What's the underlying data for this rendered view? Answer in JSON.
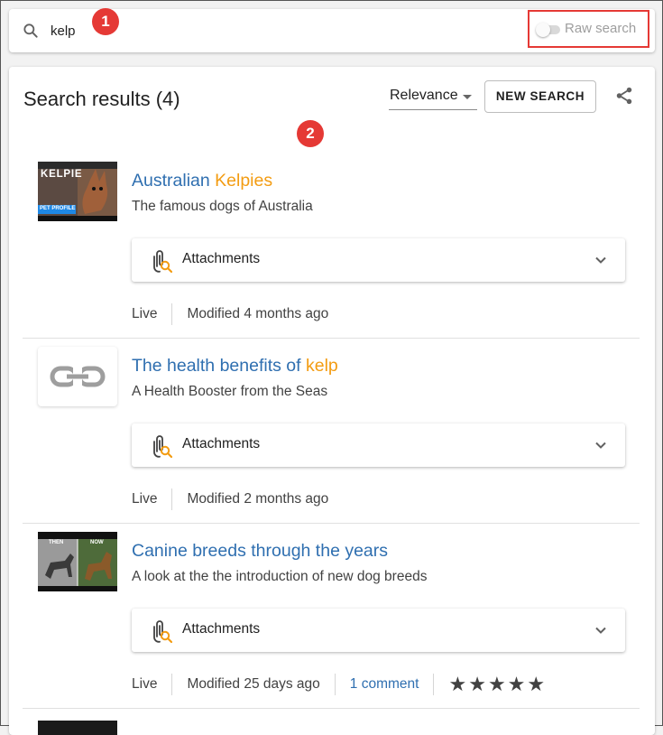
{
  "search": {
    "query": "kelp",
    "raw_search_label": "Raw search",
    "raw_search_on": false
  },
  "markers": [
    "1",
    "2"
  ],
  "results_header": {
    "title": "Search results (4)",
    "sort_value": "Relevance",
    "new_search_label": "NEW SEARCH"
  },
  "results": [
    {
      "title_prefix": "Australian ",
      "title_highlight": "Kelpies",
      "title_suffix": "",
      "subtitle": "The famous dogs of Australia",
      "thumb_text": "KELPIE",
      "thumb_tag": "PET PROFILE",
      "attachments_label": "Attachments",
      "status": "Live",
      "modified": "Modified 4 months ago"
    },
    {
      "title_prefix": "The health benefits of ",
      "title_highlight": "kelp",
      "title_suffix": "",
      "subtitle": "A Health Booster from the Seas",
      "attachments_label": "Attachments",
      "status": "Live",
      "modified": "Modified 2 months ago"
    },
    {
      "title_prefix": "Canine breeds through the years",
      "title_highlight": "",
      "title_suffix": "",
      "subtitle": "A look at the the introduction of new dog breeds",
      "thumb_left": "THEN",
      "thumb_right": "NOW",
      "attachments_label": "Attachments",
      "status": "Live",
      "modified": "Modified 25 days ago",
      "comments": "1 comment",
      "rating": 5
    }
  ],
  "colors": {
    "link": "#2f6fb0",
    "highlight": "#f39c12",
    "marker": "#e53935"
  }
}
